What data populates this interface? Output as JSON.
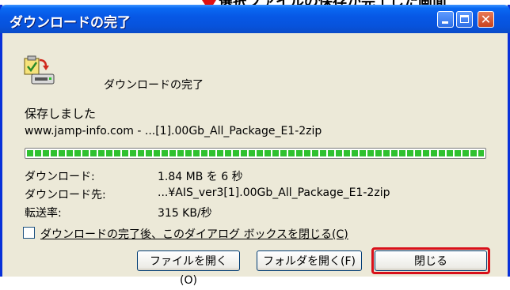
{
  "annotation": {
    "text": "選択ファイルの保存が完了した画面"
  },
  "window": {
    "title": "ダウンロードの完了",
    "controls": {
      "close_glyph": "✕"
    }
  },
  "header": {
    "heading": "ダウンロードの完了"
  },
  "status": {
    "saved": "保存しました",
    "source": "www.jamp-info.com - ...[1].00Gb_All_Package_E1-2zip"
  },
  "progress": {
    "fraction": 1.0
  },
  "details": [
    {
      "label": "ダウンロード:",
      "value": "1.84 MB を 6 秒"
    },
    {
      "label": "ダウンロード先:",
      "value": "...¥AIS_ver3[1].00Gb_All_Package_E1-2zip"
    },
    {
      "label": "転送率:",
      "value": "315 KB/秒"
    }
  ],
  "close_on_complete": {
    "checked": false,
    "label": "ダウンロードの完了後、このダイアログ ボックスを閉じる(C)"
  },
  "buttons": {
    "open_file": "ファイルを開く(O)",
    "open_folder": "フォルダを開く(F)",
    "close": "閉じる"
  },
  "colors": {
    "titlebar": "#0753DC",
    "dialog_bg": "#ECE9D8",
    "progress": "#2FC12F",
    "highlight": "#D8101A"
  },
  "icons": [
    "download-complete-icon",
    "minimize-icon",
    "maximize-icon",
    "close-icon"
  ]
}
